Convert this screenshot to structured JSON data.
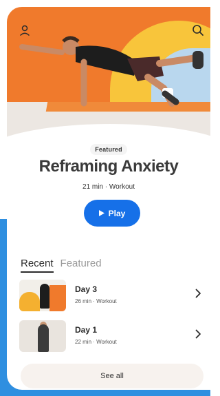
{
  "header": {
    "profile_icon": "person-outline-icon",
    "search_icon": "search-icon"
  },
  "hero": {
    "image": "man doing bird-dog pose on orange mat",
    "colors": {
      "orange": "#f07a2c",
      "yellow": "#f8c53b",
      "light_blue": "#b9d7ee"
    }
  },
  "content": {
    "badge": "Featured",
    "title": "Reframing Anxiety",
    "subtitle": "21 min · Workout",
    "play_label": "Play",
    "play_icon": "play-icon",
    "accent": "#1670e8"
  },
  "tabs": [
    {
      "label": "Recent",
      "active": true
    },
    {
      "label": "Featured",
      "active": false
    }
  ],
  "list": [
    {
      "name": "Day 3",
      "meta": "26 min · Workout",
      "chevron": "chevron-right-icon"
    },
    {
      "name": "Day 1",
      "meta": "22 min · Workout",
      "chevron": "chevron-right-icon"
    }
  ],
  "footer": {
    "see_all_label": "See all"
  }
}
